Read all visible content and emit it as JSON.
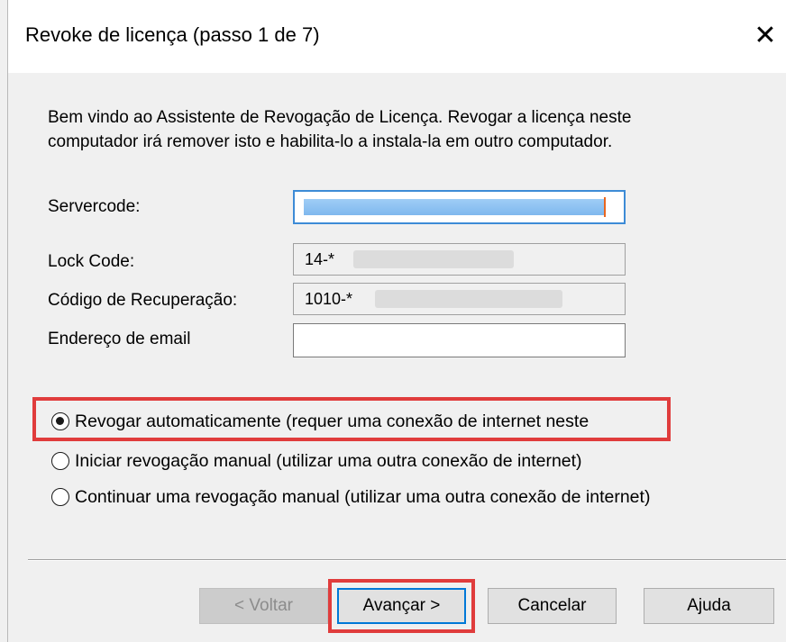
{
  "window": {
    "title": "Revoke de licença (passo 1 de 7)",
    "close_glyph": "✕"
  },
  "intro_text": "Bem vindo ao Assistente de Revogação de Licença. Revogar a licença neste computador irá remover isto e habilita-lo a instala-la em outro computador.",
  "fields": {
    "servercode_label": "Servercode:",
    "servercode_value": "",
    "lockcode_label": "Lock Code:",
    "lockcode_value": "14-*",
    "recovery_label": "Código de Recuperação:",
    "recovery_value": "1010-*",
    "email_label": "Endereço de email",
    "email_value": ""
  },
  "options": [
    {
      "label": "Revogar automaticamente (requer uma conexão de internet neste",
      "checked": true
    },
    {
      "label": "Iniciar revogação manual (utilizar uma outra conexão de internet)",
      "checked": false
    },
    {
      "label": "Continuar uma revogação manual (utilizar uma outra conexão de internet)",
      "checked": false
    }
  ],
  "buttons": {
    "back": "< Voltar",
    "next": "Avançar >",
    "cancel": "Cancelar",
    "help": "Ajuda"
  },
  "colors": {
    "highlight": "#e03c3c",
    "focus": "#3d8bd6",
    "selection": "#7fb8ee"
  }
}
